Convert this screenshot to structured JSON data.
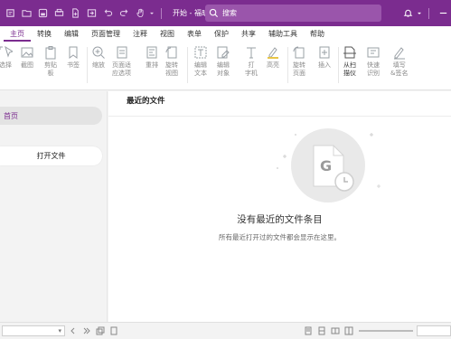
{
  "titlebar": {
    "doc_title": "开始 - 福昕...",
    "search_placeholder": "搜索",
    "bg_color": "#7b2c8f"
  },
  "tabs": [
    {
      "label": "主页",
      "active": true
    },
    {
      "label": "转换"
    },
    {
      "label": "编辑"
    },
    {
      "label": "页面管理"
    },
    {
      "label": "注释"
    },
    {
      "label": "视图"
    },
    {
      "label": "表单"
    },
    {
      "label": "保护"
    },
    {
      "label": "共享"
    },
    {
      "label": "辅助工具"
    },
    {
      "label": "帮助"
    }
  ],
  "ribbon": {
    "select": "选择",
    "screenshot": "截图",
    "clipboard": "剪贴\n板",
    "bookmark": "书签",
    "zoom": "缩放",
    "page_fit": "页面适\n应选项",
    "reflow": "重排",
    "rotate_view": "旋转\n视图",
    "edit_text": "编辑\n文本",
    "edit_object": "编辑\n对象",
    "typewriter": "打\n字机",
    "highlight": "高亮",
    "rotate_page": "旋转\n页面",
    "insert": "插入",
    "scan": "从扫\n描仪",
    "quick_recognize": "快速\n识别",
    "fill_sign": "填写\n&签名"
  },
  "leftnav": {
    "home": "首页",
    "open_file": "打开文件"
  },
  "main": {
    "title": "最近的文件",
    "empty_title": "没有最近的文件条目",
    "empty_subtitle": "所有最近打开过的文件都会显示在这里。"
  },
  "statusbar": {
    "page_dropdown": "▾"
  },
  "colors": {
    "accent": "#7b2c8f",
    "accent_light": "#9a55ab",
    "illustration_bg": "#e9e9e9"
  }
}
